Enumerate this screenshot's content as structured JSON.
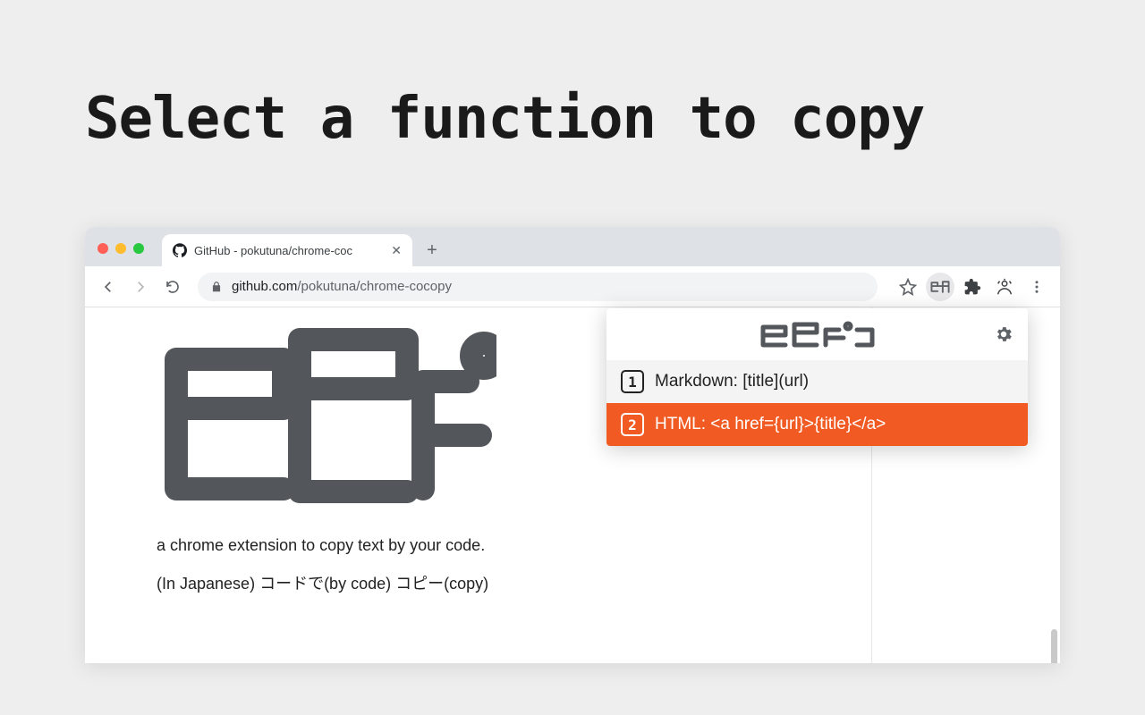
{
  "headline": "Select a function to copy",
  "browser": {
    "tab_title": "GitHub - pokutuna/chrome-coc",
    "url_host": "github.com",
    "url_path": "/pokutuna/chrome-cocopy"
  },
  "page": {
    "description": "a chrome extension to copy text by your code.",
    "description_jp": "(In Japanese) コードで(by code) コピー(copy)"
  },
  "popup": {
    "items": [
      {
        "key": "1",
        "label": "Markdown: [title](url)",
        "selected": false
      },
      {
        "key": "2",
        "label": "HTML: <a href={url}>{title}</a>",
        "selected": true
      }
    ]
  },
  "colors": {
    "accent": "#f15a22"
  }
}
